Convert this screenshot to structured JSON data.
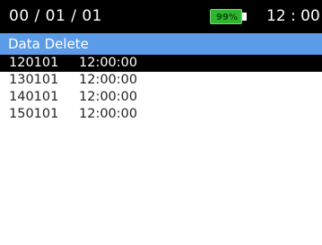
{
  "status": {
    "date": "00 / 01 / 01",
    "battery_percent": "99%",
    "time": "12 : 00",
    "battery_color": "#2fb52f"
  },
  "title": "Data Delete",
  "records": [
    {
      "date": "120101",
      "time": "12:00:00",
      "selected": true
    },
    {
      "date": "130101",
      "time": "12:00:00",
      "selected": false
    },
    {
      "date": "140101",
      "time": "12:00:00",
      "selected": false
    },
    {
      "date": "150101",
      "time": "12:00:00",
      "selected": false
    }
  ],
  "colors": {
    "status_bar": "#000000",
    "title_bar": "#5b9be8",
    "selected_row": "#000000"
  }
}
